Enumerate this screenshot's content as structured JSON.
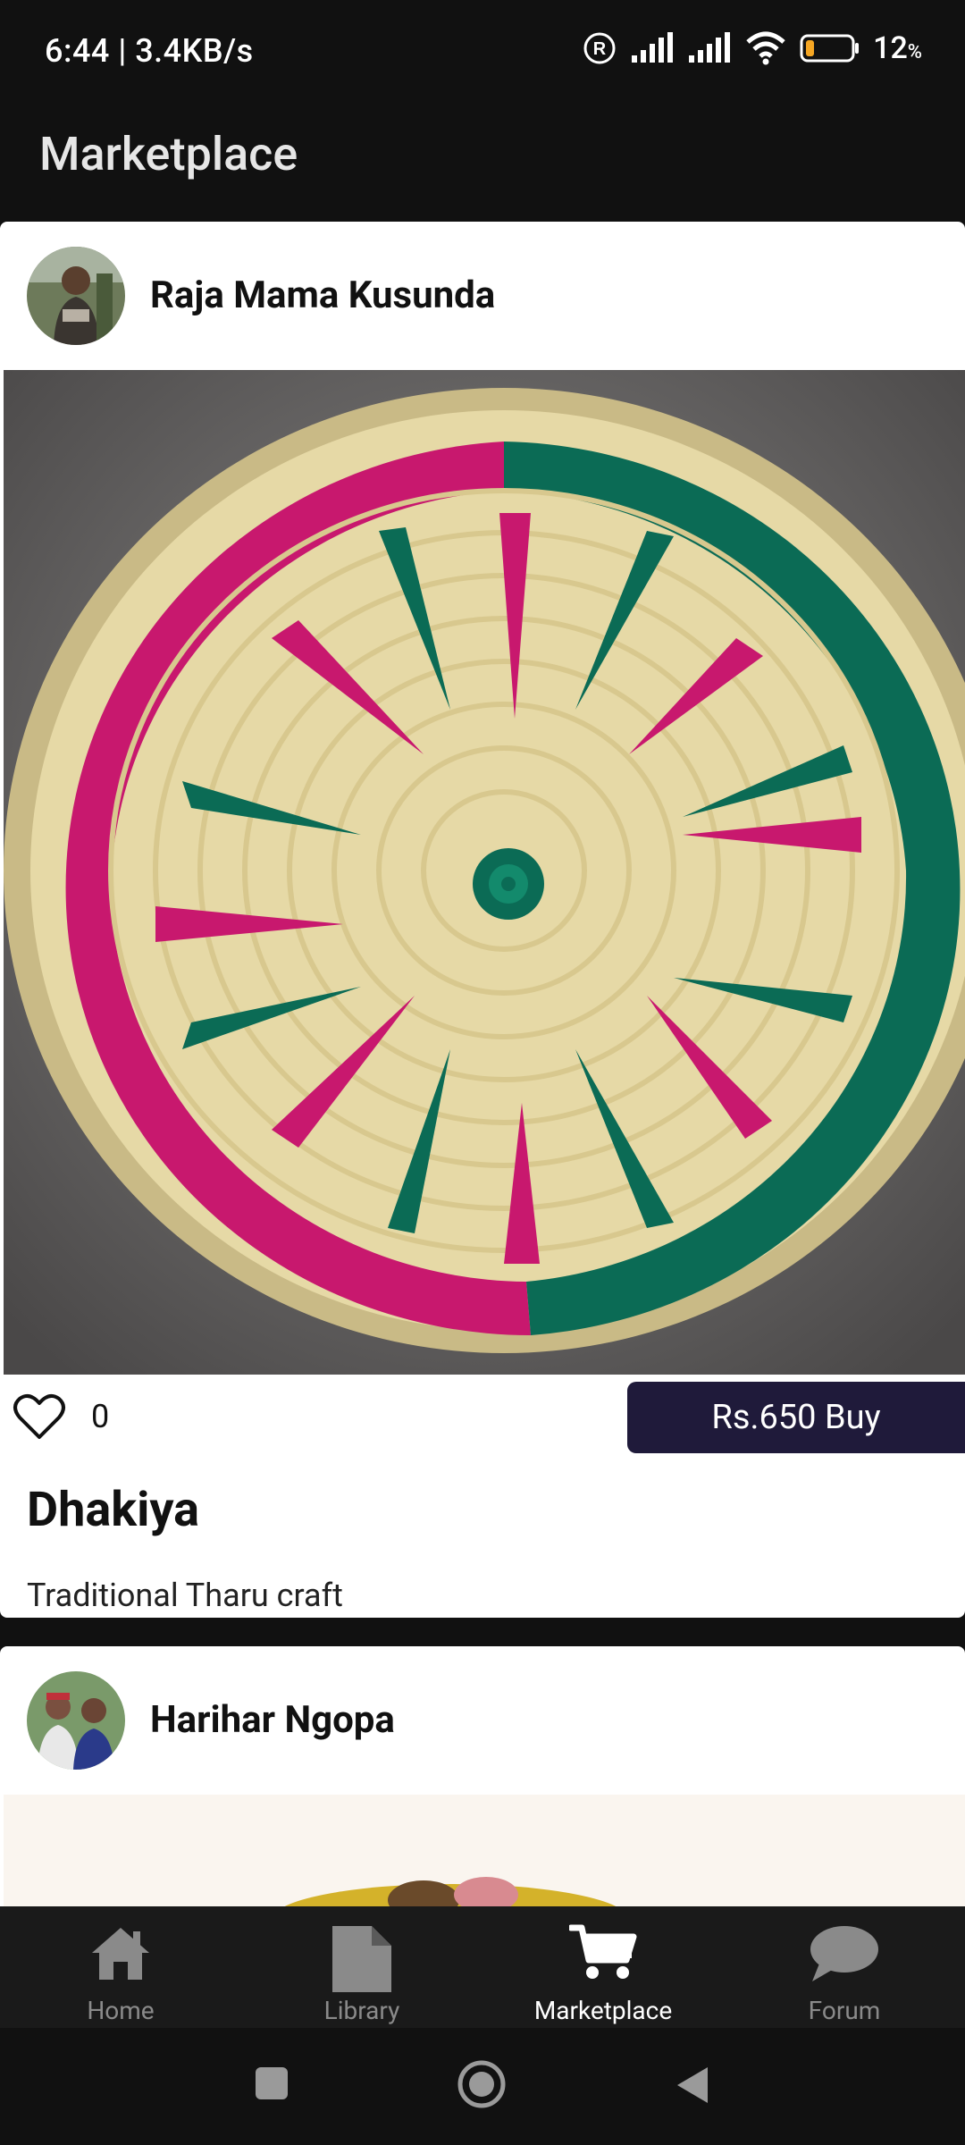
{
  "status_bar": {
    "time_speed": "6:44 | 3.4KB/s",
    "battery_percent": "12",
    "battery_unit": "%"
  },
  "app_bar": {
    "title": "Marketplace"
  },
  "posts": [
    {
      "seller": "Raja Mama Kusunda",
      "likes": "0",
      "buy_label": "Rs.650 Buy",
      "title": "Dhakiya",
      "description": "Traditional Tharu craft"
    },
    {
      "seller": "Harihar Ngopa"
    }
  ],
  "bottom_nav": [
    {
      "label": "Home",
      "icon": "home-icon",
      "active": false
    },
    {
      "label": "Library",
      "icon": "document-icon",
      "active": false
    },
    {
      "label": "Marketplace",
      "icon": "cart-icon",
      "active": true
    },
    {
      "label": "Forum",
      "icon": "chat-bubble-icon",
      "active": false
    }
  ],
  "colors": {
    "background": "#111111",
    "buy_button": "#1f1a3a",
    "basket_magenta": "#c8186e",
    "basket_green": "#0b6b55",
    "basket_straw": "#e8dcaa"
  }
}
